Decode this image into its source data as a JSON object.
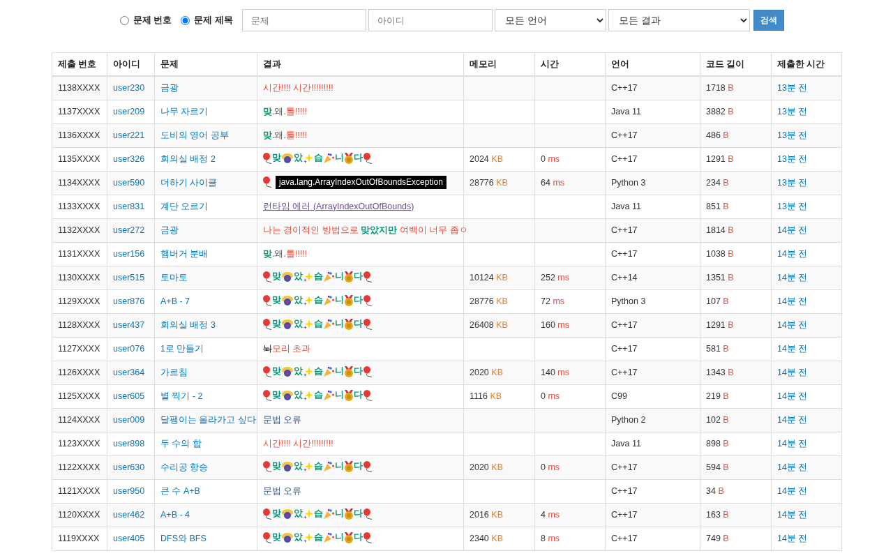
{
  "search": {
    "modes": [
      {
        "label": "문제 번호",
        "selected": false
      },
      {
        "label": "문제 제목",
        "selected": true
      }
    ],
    "problem_field": {
      "placeholder": "문제"
    },
    "user_field": {
      "placeholder": "아이디"
    },
    "language_select": {
      "value": "모든 언어"
    },
    "result_select": {
      "value": "모든 결과"
    },
    "button": "검색"
  },
  "table": {
    "columns": [
      "제출 번호",
      "아이디",
      "문제",
      "결과",
      "메모리",
      "시간",
      "언어",
      "코드 길이",
      "제출한 시간"
    ],
    "rows": [
      {
        "id": "1138XXXX",
        "user": "user230",
        "problem": "금광",
        "result": {
          "kind": "text",
          "parts": [
            {
              "text": "시간!!!! 시간!!!!!!!!!",
              "color": "#e74c3c"
            }
          ]
        },
        "language": "C++17",
        "length": {
          "value": "1718",
          "unit": "B"
        },
        "submitted": "13분 전"
      },
      {
        "id": "1137XXXX",
        "user": "user209",
        "problem": "나무 자르기",
        "result": {
          "kind": "text",
          "parts": [
            {
              "text": "맞",
              "color": "#009874",
              "bold": true
            },
            {
              "text": ".왜.",
              "color": "#555555"
            },
            {
              "text": "틀!!!!!",
              "color": "#e74c3c"
            }
          ]
        },
        "language": "Java 11",
        "length": {
          "value": "3882",
          "unit": "B"
        },
        "submitted": "13분 전"
      },
      {
        "id": "1136XXXX",
        "user": "user221",
        "problem": "도비의 영어 공부",
        "result": {
          "kind": "text",
          "parts": [
            {
              "text": "맞",
              "color": "#009874",
              "bold": true
            },
            {
              "text": ".왜.",
              "color": "#555555"
            },
            {
              "text": "틀!!!!!",
              "color": "#e74c3c"
            }
          ]
        },
        "language": "C++17",
        "length": {
          "value": "486",
          "unit": "B"
        },
        "submitted": "13분 전"
      },
      {
        "id": "1135XXXX",
        "user": "user326",
        "problem": "회의실 배정 2",
        "result": {
          "kind": "ac",
          "letters": [
            "맞",
            "았",
            "습",
            "니",
            "다"
          ]
        },
        "memory": {
          "value": "2024",
          "unit": "KB"
        },
        "time": {
          "value": "0",
          "unit": "ms"
        },
        "language": "C++17",
        "length": {
          "value": "1291",
          "unit": "B"
        },
        "submitted": "13분 전"
      },
      {
        "id": "1134XXXX",
        "user": "user590",
        "problem": "더하기 사이클",
        "result": {
          "kind": "covered",
          "tooltip": "java.lang.ArrayIndexOutOfBoundsException"
        },
        "memory": {
          "value": "28776",
          "unit": "KB"
        },
        "time": {
          "value": "64",
          "unit": "ms"
        },
        "language": "Python 3",
        "length": {
          "value": "234",
          "unit": "B"
        },
        "submitted": "13분 전"
      },
      {
        "id": "1133XXXX",
        "user": "user831",
        "problem": "계단 오르기",
        "result": {
          "kind": "link",
          "parts": [
            {
              "text": "런타임 에러 (ArrayIndexOutOfBounds)",
              "color": "#6b4c9a"
            }
          ]
        },
        "language": "Java 11",
        "length": {
          "value": "851",
          "unit": "B"
        },
        "submitted": "13분 전"
      },
      {
        "id": "1132XXXX",
        "user": "user272",
        "problem": "금광",
        "result": {
          "kind": "text",
          "parts": [
            {
              "text": "나는 경이적인 방법으로 ",
              "color": "#e74c3c"
            },
            {
              "text": "맞았지만",
              "color": "#009874",
              "bold": true
            },
            {
              "text": " 여백이 너무 좁ㅇ",
              "color": "#e74c3c"
            }
          ]
        },
        "language": "C++17",
        "length": {
          "value": "1814",
          "unit": "B"
        },
        "submitted": "14분 전"
      },
      {
        "id": "1131XXXX",
        "user": "user156",
        "problem": "햄버거 분배",
        "result": {
          "kind": "text",
          "parts": [
            {
              "text": "맞",
              "color": "#009874",
              "bold": true
            },
            {
              "text": ".왜.",
              "color": "#555555"
            },
            {
              "text": "틀!!!!!",
              "color": "#e74c3c"
            }
          ]
        },
        "language": "C++17",
        "length": {
          "value": "1038",
          "unit": "B"
        },
        "submitted": "14분 전"
      },
      {
        "id": "1130XXXX",
        "user": "user515",
        "problem": "토마토",
        "result": {
          "kind": "ac",
          "letters": [
            "맞",
            "았",
            "습",
            "니",
            "다"
          ]
        },
        "memory": {
          "value": "10124",
          "unit": "KB"
        },
        "time": {
          "value": "252",
          "unit": "ms"
        },
        "language": "C++14",
        "length": {
          "value": "1351",
          "unit": "B"
        },
        "submitted": "14분 전"
      },
      {
        "id": "1129XXXX",
        "user": "user876",
        "problem": "A+B - 7",
        "result": {
          "kind": "ac",
          "letters": [
            "맞",
            "았",
            "습",
            "니",
            "다"
          ]
        },
        "memory": {
          "value": "28776",
          "unit": "KB"
        },
        "time": {
          "value": "72",
          "unit": "ms"
        },
        "language": "Python 3",
        "length": {
          "value": "107",
          "unit": "B"
        },
        "submitted": "14분 전"
      },
      {
        "id": "1128XXXX",
        "user": "user437",
        "problem": "회의실 배정 3",
        "result": {
          "kind": "ac",
          "letters": [
            "맞",
            "았",
            "습",
            "니",
            "다"
          ]
        },
        "memory": {
          "value": "26408",
          "unit": "KB"
        },
        "time": {
          "value": "160",
          "unit": "ms"
        },
        "language": "C++17",
        "length": {
          "value": "1291",
          "unit": "B"
        },
        "submitted": "14분 전"
      },
      {
        "id": "1127XXXX",
        "user": "user076",
        "problem": "1로 만들기",
        "result": {
          "kind": "text",
          "parts": [
            {
              "text": "뇌",
              "color": "#222222",
              "struck": true
            },
            {
              "text": "모리 초과",
              "color": "#e74c3c"
            }
          ]
        },
        "language": "C++17",
        "length": {
          "value": "581",
          "unit": "B"
        },
        "submitted": "14분 전"
      },
      {
        "id": "1126XXXX",
        "user": "user364",
        "problem": "가르침",
        "result": {
          "kind": "ac",
          "letters": [
            "맞",
            "았",
            "습",
            "니",
            "다"
          ]
        },
        "memory": {
          "value": "2020",
          "unit": "KB"
        },
        "time": {
          "value": "140",
          "unit": "ms"
        },
        "language": "C++17",
        "length": {
          "value": "1343",
          "unit": "B"
        },
        "submitted": "14분 전"
      },
      {
        "id": "1125XXXX",
        "user": "user605",
        "problem": "별 찍기 - 2",
        "result": {
          "kind": "ac",
          "letters": [
            "맞",
            "았",
            "습",
            "니",
            "다"
          ]
        },
        "memory": {
          "value": "1116",
          "unit": "KB"
        },
        "time": {
          "value": "0",
          "unit": "ms"
        },
        "language": "C99",
        "length": {
          "value": "219",
          "unit": "B"
        },
        "submitted": "14분 전"
      },
      {
        "id": "1124XXXX",
        "user": "user009",
        "problem": "달팽이는 올라가고 싶다",
        "result": {
          "kind": "text",
          "parts": [
            {
              "text": "문법 오류",
              "color": "#34578a"
            }
          ]
        },
        "language": "Python 2",
        "length": {
          "value": "102",
          "unit": "B"
        },
        "submitted": "14분 전"
      },
      {
        "id": "1123XXXX",
        "user": "user898",
        "problem": "두 수의 합",
        "result": {
          "kind": "text",
          "parts": [
            {
              "text": "시간!!!! 시간!!!!!!!!!",
              "color": "#e74c3c"
            }
          ]
        },
        "language": "Java 11",
        "length": {
          "value": "898",
          "unit": "B"
        },
        "submitted": "14분 전"
      },
      {
        "id": "1122XXXX",
        "user": "user630",
        "problem": "수리공 항승",
        "result": {
          "kind": "ac",
          "letters": [
            "맞",
            "았",
            "습",
            "니",
            "다"
          ]
        },
        "memory": {
          "value": "2020",
          "unit": "KB"
        },
        "time": {
          "value": "0",
          "unit": "ms"
        },
        "language": "C++17",
        "length": {
          "value": "594",
          "unit": "B"
        },
        "submitted": "14분 전"
      },
      {
        "id": "1121XXXX",
        "user": "user950",
        "problem": "큰 수 A+B",
        "result": {
          "kind": "text",
          "parts": [
            {
              "text": "문법 오류",
              "color": "#34578a"
            }
          ]
        },
        "language": "C++17",
        "length": {
          "value": "34",
          "unit": "B"
        },
        "submitted": "14분 전"
      },
      {
        "id": "1120XXXX",
        "user": "user462",
        "problem": "A+B - 4",
        "result": {
          "kind": "ac",
          "letters": [
            "맞",
            "았",
            "습",
            "니",
            "다"
          ]
        },
        "memory": {
          "value": "2016",
          "unit": "KB"
        },
        "time": {
          "value": "4",
          "unit": "ms"
        },
        "language": "C++17",
        "length": {
          "value": "163",
          "unit": "B"
        },
        "submitted": "14분 전"
      },
      {
        "id": "1119XXXX",
        "user": "user405",
        "problem": "DFS와 BFS",
        "result": {
          "kind": "ac",
          "letters": [
            "맞",
            "았",
            "습",
            "니",
            "다"
          ]
        },
        "memory": {
          "value": "2340",
          "unit": "KB"
        },
        "time": {
          "value": "8",
          "unit": "ms"
        },
        "language": "C++17",
        "length": {
          "value": "749",
          "unit": "B"
        },
        "submitted": "14분 전"
      }
    ]
  }
}
